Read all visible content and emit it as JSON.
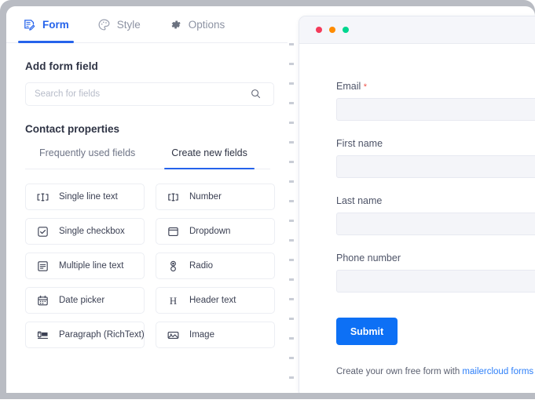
{
  "tabs": [
    {
      "label": "Form",
      "icon": "form-icon",
      "active": true
    },
    {
      "label": "Style",
      "icon": "palette-icon",
      "active": false
    },
    {
      "label": "Options",
      "icon": "gear-icon",
      "active": false
    }
  ],
  "sidebar": {
    "add_form_field_title": "Add form field",
    "search_placeholder": "Search for fields",
    "search_value": "",
    "contact_properties_title": "Contact properties",
    "subtabs": [
      {
        "label": "Frequently used fields",
        "active": false
      },
      {
        "label": "Create new fields",
        "active": true
      }
    ],
    "fields": [
      {
        "label": "Single line text",
        "icon": "single-line-text-icon"
      },
      {
        "label": "Number",
        "icon": "number-icon"
      },
      {
        "label": "Single checkbox",
        "icon": "checkbox-icon"
      },
      {
        "label": "Dropdown",
        "icon": "dropdown-icon"
      },
      {
        "label": "Multiple line text",
        "icon": "multiline-text-icon"
      },
      {
        "label": "Radio",
        "icon": "radio-icon"
      },
      {
        "label": "Date picker",
        "icon": "calendar-icon"
      },
      {
        "label": "Header text",
        "icon": "header-text-icon"
      },
      {
        "label": "Paragraph (RichText)",
        "icon": "richtext-icon"
      },
      {
        "label": "Image",
        "icon": "image-icon"
      }
    ]
  },
  "preview": {
    "window_dots": [
      "#f43b5a",
      "#ff8c00",
      "#00d68f"
    ],
    "fields": [
      {
        "label": "Email",
        "required": true,
        "value": ""
      },
      {
        "label": "First name",
        "required": false,
        "value": ""
      },
      {
        "label": "Last name",
        "required": false,
        "value": ""
      },
      {
        "label": "Phone number",
        "required": false,
        "value": ""
      }
    ],
    "submit_label": "Submit",
    "footer_text": "Create your own free form with ",
    "footer_link": "mailercloud forms"
  },
  "colors": {
    "accent": "#2563eb",
    "submit": "#0d70f5",
    "required": "#f0544c",
    "link": "#2d7ff9"
  }
}
